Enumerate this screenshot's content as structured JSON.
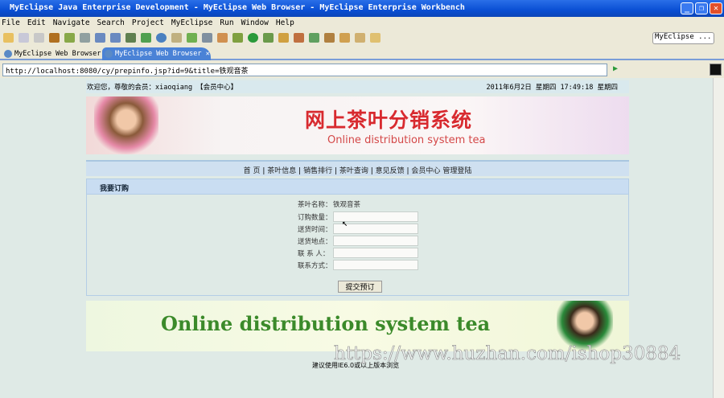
{
  "window": {
    "title": "MyEclipse Java Enterprise Development - MyEclipse Web Browser - MyEclipse Enterprise Workbench"
  },
  "menu": [
    "File",
    "Edit",
    "Navigate",
    "Search",
    "Project",
    "MyEclipse",
    "Run",
    "Window",
    "Help"
  ],
  "perspective": "MyEclipse ...",
  "tabs": [
    {
      "label": "MyEclipse Web Browser"
    },
    {
      "label": "MyEclipse Web Browser",
      "close": "✕"
    }
  ],
  "address": "http://localhost:8080/cy/prepinfo.jsp?id=9&title=铁观音茶",
  "site": {
    "welcome": "欢迎您，尊敬的会员：xiaoqiang 【会员中心】",
    "datetime": "2011年6月2日 星期四 17:49:18  星期四",
    "banner_cn": "网上茶叶分销系统",
    "banner_en": "Online distribution system tea",
    "nav": [
      "首 页",
      "茶叶信息",
      "销售排行",
      "茶叶查询",
      "意见反馈",
      "会员中心",
      "管理登陆"
    ],
    "section_title": "我要订购",
    "form": {
      "name_label": "茶叶名称：",
      "name_value": "铁观音茶",
      "qty_label": "订购数量：",
      "time_label": "送货时间：",
      "addr_label": "送货地点：",
      "contact_label": "联 系 人：",
      "phone_label": "联系方式：",
      "submit": "提交预订"
    },
    "bottom_banner": "Online distribution system tea",
    "footer": "建议使用IE6.0或以上版本浏览"
  },
  "watermark": "https://www.huzhan.com/ishop30884"
}
